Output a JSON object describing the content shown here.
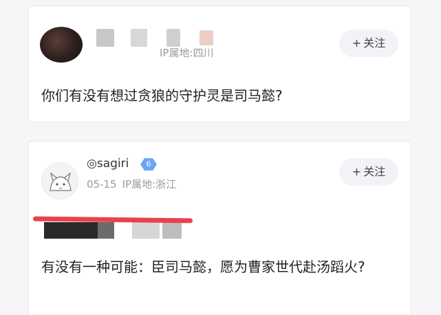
{
  "post1": {
    "location": "IP属地:四川",
    "follow_label": "关注",
    "content": "你们有没有想过贪狼的守护灵是司马懿?"
  },
  "post2": {
    "username": "◎sagiri",
    "level": "6",
    "date": "05-15",
    "location": "IP属地:浙江",
    "follow_label": "关注",
    "content": "有没有一种可能：臣司马懿，愿为曹家世代赴汤蹈火?"
  }
}
